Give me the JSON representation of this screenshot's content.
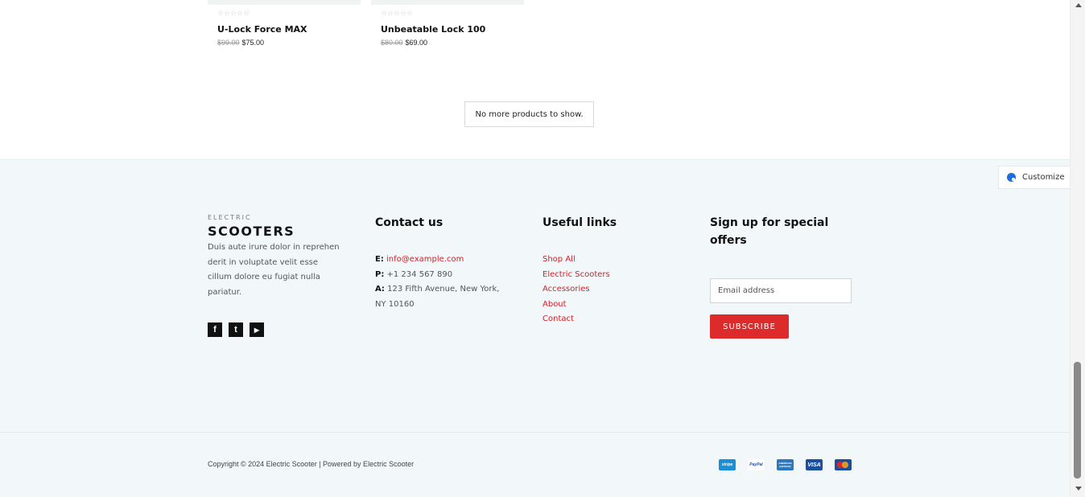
{
  "products": [
    {
      "stars": "☆☆☆☆☆",
      "name": "U-Lock Force MAX",
      "old_price": "$99.00",
      "new_price": "$75.00"
    },
    {
      "stars": "☆☆☆☆☆",
      "name": "Unbeatable Lock 100",
      "old_price": "$80.00",
      "new_price": "$69.00"
    }
  ],
  "no_more": "No more products to show.",
  "customize": "Customize",
  "brand": {
    "small": "ELECTRIC",
    "big": "SCOOTERS",
    "about": "Duis aute irure dolor in reprehen derit in voluptate velit esse cillum dolore eu fugiat nulla pariatur."
  },
  "socials": {
    "facebook": "f",
    "twitter": "t",
    "youtube": "▶"
  },
  "contact": {
    "title": "Contact us",
    "email_label": "E:",
    "email": "info@example.com",
    "phone_label": "P:",
    "phone": "+1 234 567 890",
    "address_label": "A:",
    "address": "123 Fifth Avenue, New York, NY 10160"
  },
  "useful_links": {
    "title": "Useful links",
    "items": [
      "Shop All",
      "Electric Scooters",
      "Accessories",
      "About",
      "Contact"
    ]
  },
  "signup": {
    "title": "Sign up for special offers",
    "placeholder": "Email address",
    "button": "SUBSCRIBE"
  },
  "copyright": "Copyright © 2024 Electric Scooter | Powered by Electric Scooter",
  "payments": [
    "stripe",
    "PayPal",
    "AMERICAN EXPRESS",
    "VISA",
    "mastercard"
  ],
  "colors": {
    "accent": "#dd2b2b",
    "link": "#d4202a",
    "footer_bg": "#f2f8f9"
  }
}
